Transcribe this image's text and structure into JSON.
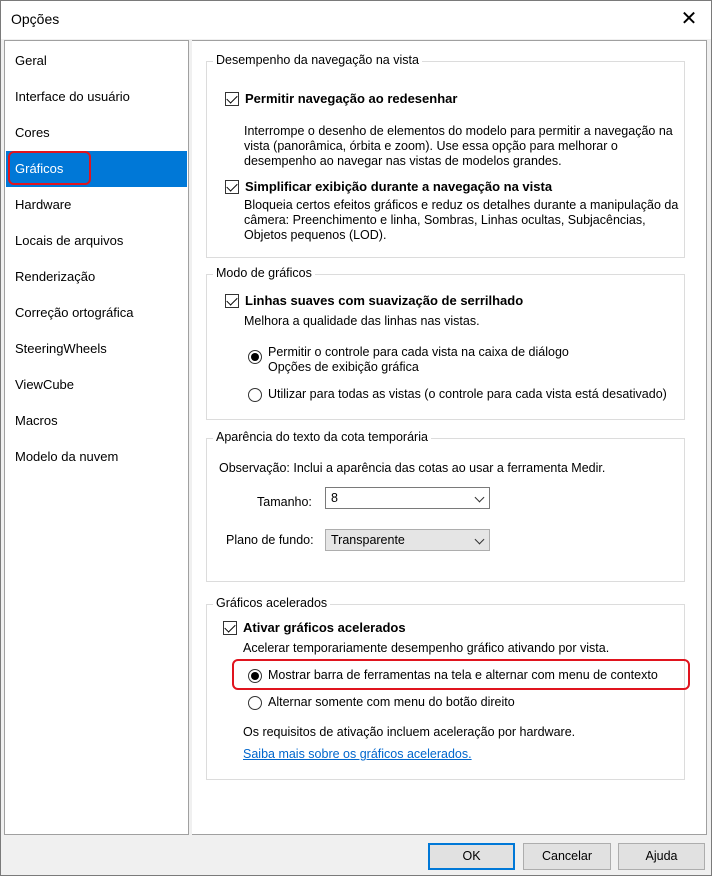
{
  "window": {
    "title": "Opções",
    "close_glyph": "✕"
  },
  "sidebar": {
    "items": [
      {
        "label": "Geral"
      },
      {
        "label": "Interface do usuário"
      },
      {
        "label": "Cores"
      },
      {
        "label": "Gráficos",
        "selected": true
      },
      {
        "label": "Hardware"
      },
      {
        "label": "Locais de arquivos"
      },
      {
        "label": "Renderização"
      },
      {
        "label": "Correção ortográfica"
      },
      {
        "label": "SteeringWheels"
      },
      {
        "label": "ViewCube"
      },
      {
        "label": "Macros"
      },
      {
        "label": "Modelo da nuvem"
      }
    ]
  },
  "nav_performance": {
    "legend": "Desempenho da navegação na vista",
    "allow_redraw": {
      "label": "Permitir navegação ao redesenhar",
      "checked": true,
      "description": "Interrompe o desenho de elementos do modelo para permitir a navegação na vista (panorâmica, órbita e zoom). Use essa opção para melhorar o desempenho ao navegar nas vistas de modelos grandes."
    },
    "simplify": {
      "label": "Simplificar exibição durante a navegação na vista",
      "checked": true,
      "description": "Bloqueia certos efeitos gráficos e reduz os detalhes durante a manipulação da câmera: Preenchimento e linha, Sombras, Linhas ocultas, Subjacências, Objetos pequenos (LOD)."
    }
  },
  "graphics_mode": {
    "legend": "Modo de gráficos",
    "antialias": {
      "label": "Linhas suaves com suavização de serrilhado",
      "checked": true,
      "description": "Melhora a qualidade das linhas nas vistas."
    },
    "radio_per_view_line1": "Permitir o controle para cada vista na caixa de diálogo",
    "radio_per_view_line2": "Opções de exibição gráfica",
    "radio_all_views": "Utilizar para todas as vistas (o controle para cada vista está desativado)",
    "selected": "per_view"
  },
  "temp_dim": {
    "legend": "Aparência do texto da cota temporária",
    "note": "Observação: Inclui a aparência das cotas ao usar a ferramenta Medir.",
    "size_label": "Tamanho:",
    "size_value": "8",
    "background_label": "Plano de fundo:",
    "background_value": "Transparente"
  },
  "accelerated": {
    "legend": "Gráficos acelerados",
    "enable": {
      "label": "Ativar gráficos acelerados",
      "checked": true,
      "description": "Acelerar temporariamente desempenho gráfico ativando por vista."
    },
    "radio_toolbar": "Mostrar barra de ferramentas na tela e alternar com menu de contexto",
    "radio_right_click": "Alternar somente com menu do botão direito",
    "selected": "toolbar",
    "requirements": "Os requisitos de ativação incluem aceleração por hardware.",
    "learn_more": "Saiba mais sobre os gráficos acelerados."
  },
  "buttons": {
    "ok": "OK",
    "cancel": "Cancelar",
    "help": "Ajuda"
  },
  "colors": {
    "accent": "#0078d7",
    "highlight": "#e0141e",
    "link": "#0066cc"
  }
}
